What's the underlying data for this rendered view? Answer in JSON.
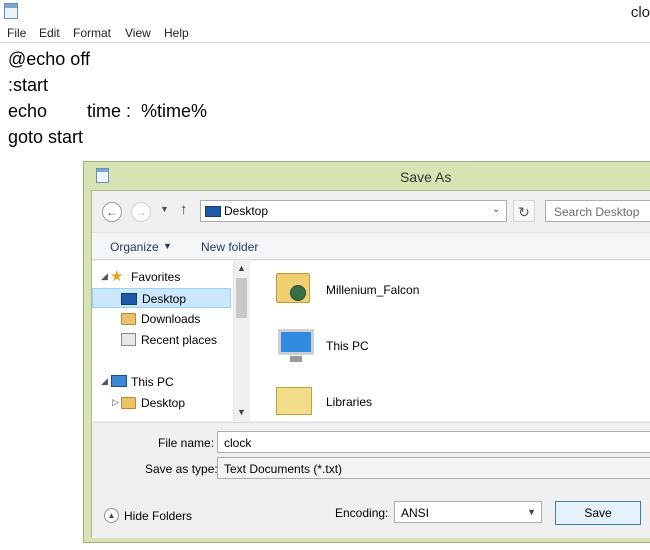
{
  "notepad": {
    "title": "clo",
    "menu": [
      "File",
      "Edit",
      "Format",
      "View",
      "Help"
    ],
    "lines": [
      "@echo off",
      ":start",
      "echo        time :  %time%",
      "goto start"
    ]
  },
  "dialog": {
    "title": "Save As",
    "address": "Desktop",
    "search_placeholder": "Search Desktop",
    "commands": {
      "organize": "Organize",
      "new_folder": "New folder"
    },
    "nav": {
      "favorites": "Favorites",
      "desktop": "Desktop",
      "downloads": "Downloads",
      "recent_places": "Recent places",
      "this_pc": "This PC",
      "pc_desktop": "Desktop"
    },
    "files": [
      "Millenium_Falcon",
      "This PC",
      "Libraries"
    ],
    "file_name_label": "File name:",
    "file_name_value": "clock",
    "save_type_label": "Save as type:",
    "save_type_value": "Text Documents (*.txt)",
    "hide_folders": "Hide Folders",
    "encoding_label": "Encoding:",
    "encoding_value": "ANSI",
    "save_label": "Save"
  }
}
